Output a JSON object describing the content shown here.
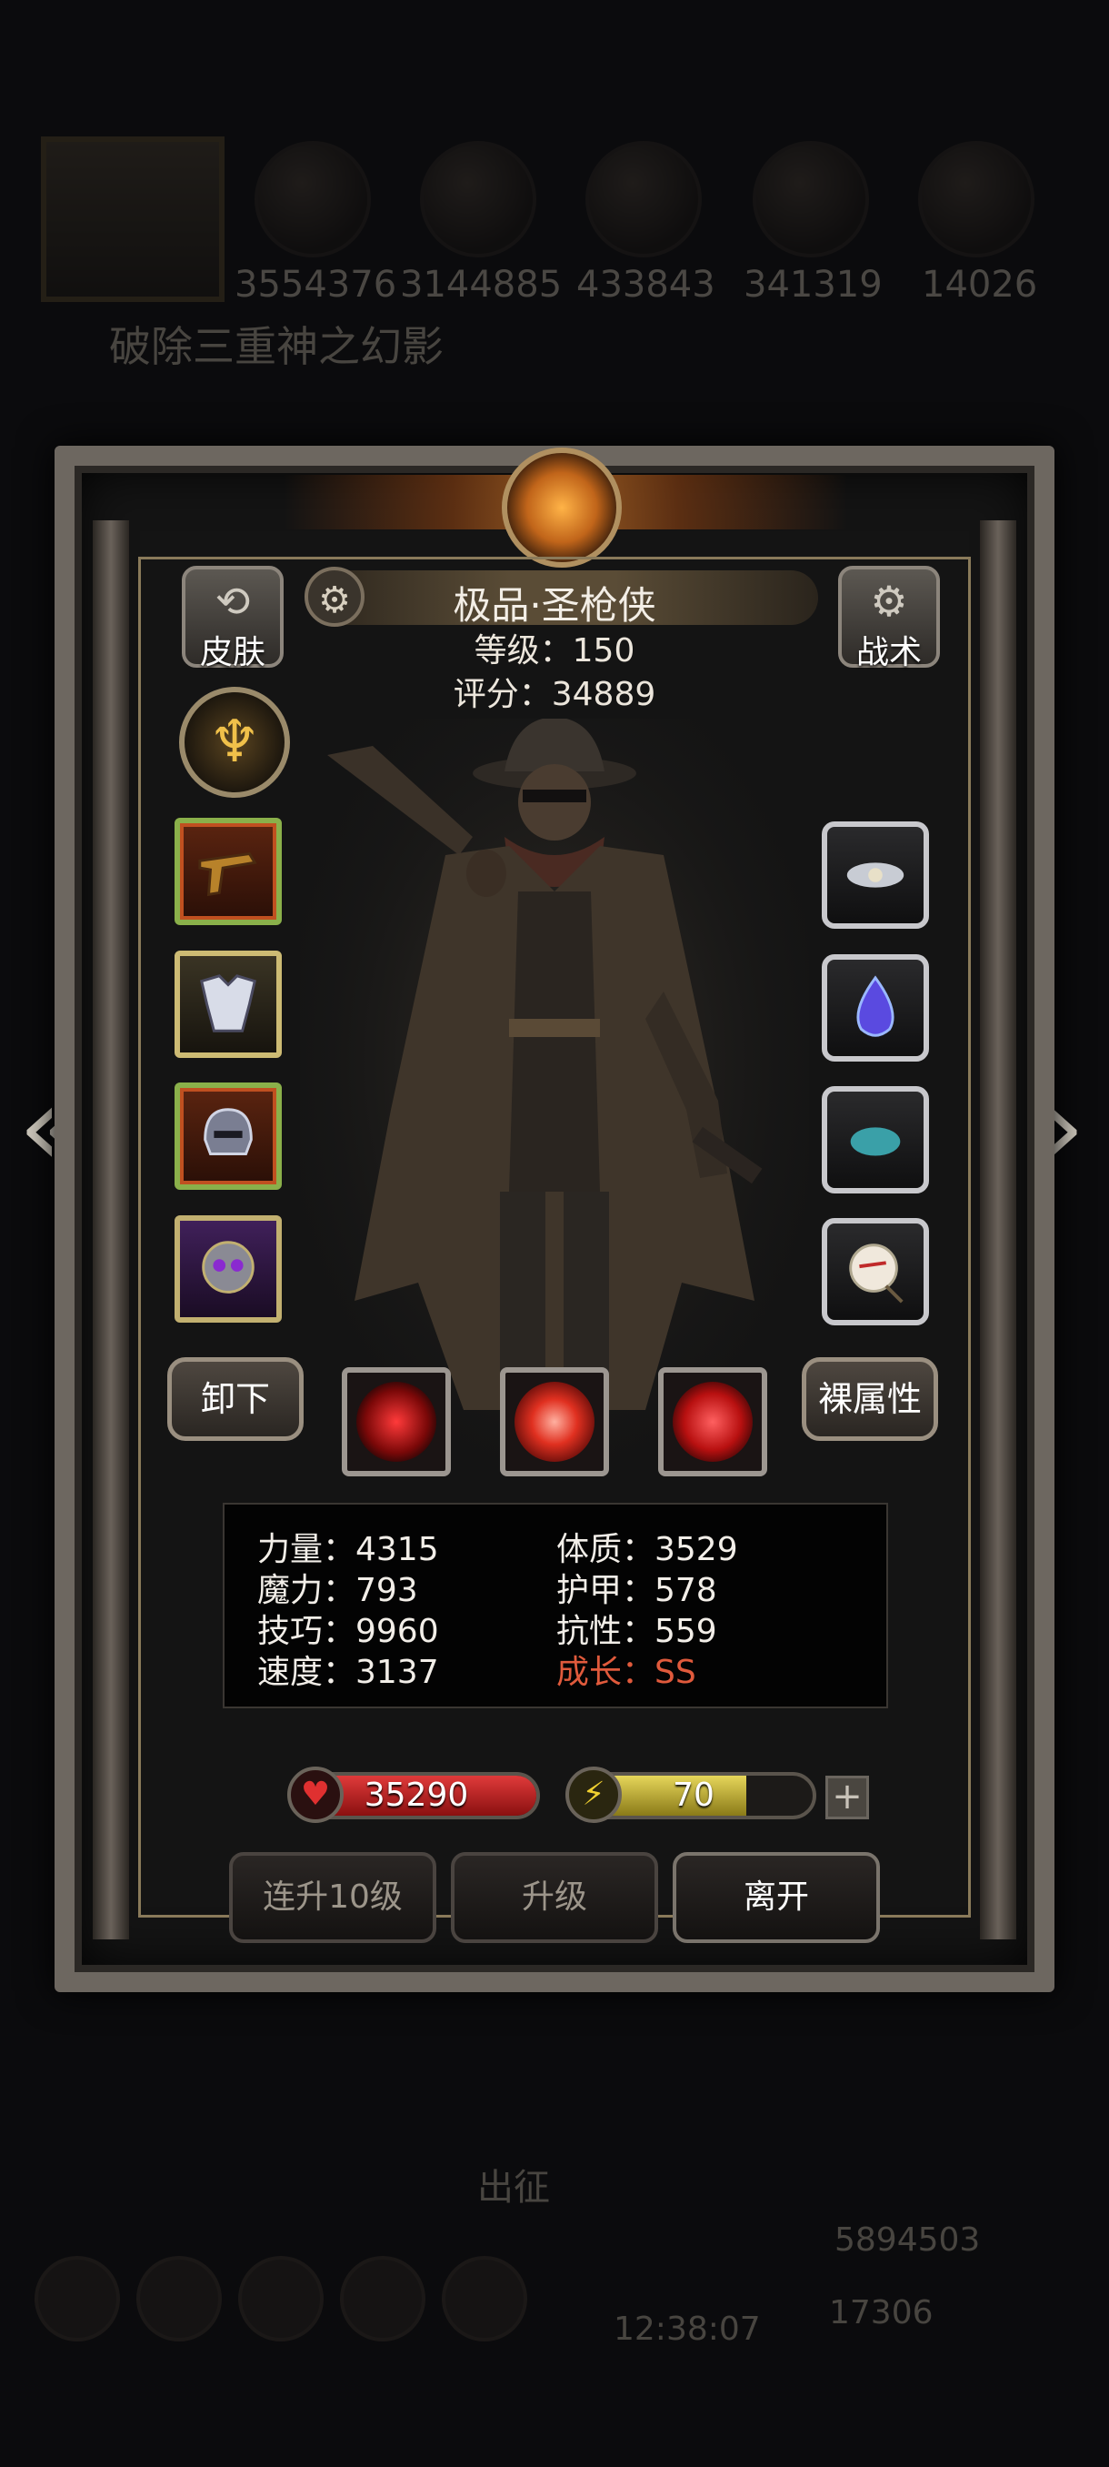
{
  "background": {
    "resources": [
      "3554376",
      "3144885",
      "433843",
      "341319",
      "14026"
    ],
    "quest_title": "破除三重神之幻影",
    "deploy_label": "出征",
    "clock": "12:38:07",
    "gold": "5894503",
    "gems": "17306"
  },
  "hero": {
    "title": "极品·圣枪侠",
    "level": "等级：150",
    "score": "评分：34889"
  },
  "buttons": {
    "skin": "皮肤",
    "tactics": "战术",
    "unequip": "卸下",
    "naked_stats": "裸属性",
    "level_up_10": "连升10级",
    "level_up": "升级",
    "leave": "离开"
  },
  "stats": {
    "strength": "力量：4315",
    "constitution": "体质：3529",
    "magic": "魔力：793",
    "armor": "护甲：578",
    "skill": "技巧：9960",
    "resistance": "抗性：559",
    "speed": "速度：3137",
    "growth": "成长：SS"
  },
  "bars": {
    "hp": "35290",
    "energy": "70",
    "energy_fill": 0.72,
    "hp_fill": 1.0
  },
  "colors": {
    "growth": "#e05a3c",
    "hp_bar": "#c42424",
    "energy_bar": "#c9b832"
  },
  "icons": {
    "skin": "shirt-refresh-icon",
    "tactics": "gear-icon",
    "title": "gear-icon",
    "emblem": "winged-emblem-icon",
    "hp": "heart-icon",
    "energy": "lightning-icon",
    "plus": "plus-icon",
    "prev": "chevron-left-icon",
    "next": "chevron-right-icon"
  }
}
